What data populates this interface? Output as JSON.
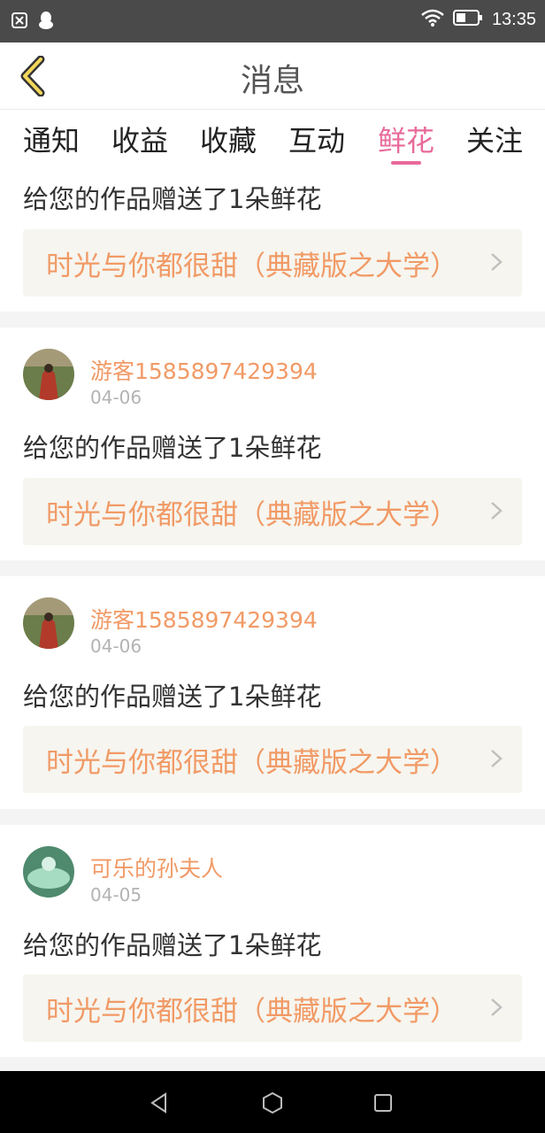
{
  "status_bar": {
    "time": "13:35",
    "icons": [
      "close-box-icon",
      "qq-icon",
      "wifi-icon",
      "battery-icon"
    ]
  },
  "header": {
    "title": "消息",
    "back_icon": "chevron-left-icon"
  },
  "tabs": [
    {
      "label": "通知",
      "active": false
    },
    {
      "label": "收益",
      "active": false
    },
    {
      "label": "收藏",
      "active": false
    },
    {
      "label": "互动",
      "active": false
    },
    {
      "label": "鲜花",
      "active": true
    },
    {
      "label": "关注",
      "active": false
    }
  ],
  "messages": [
    {
      "user": "",
      "date": "",
      "text": "给您的作品赠送了1朵鲜花",
      "work_title": "时光与你都很甜（典藏版之大学）"
    },
    {
      "user": "游客1585897429394",
      "date": "04-06",
      "text": "给您的作品赠送了1朵鲜花",
      "work_title": "时光与你都很甜（典藏版之大学）"
    },
    {
      "user": "游客1585897429394",
      "date": "04-06",
      "text": "给您的作品赠送了1朵鲜花",
      "work_title": "时光与你都很甜（典藏版之大学）"
    },
    {
      "user": "可乐的孙夫人",
      "date": "04-05",
      "text": "给您的作品赠送了1朵鲜花",
      "work_title": "时光与你都很甜（典藏版之大学）"
    }
  ],
  "colors": {
    "accent": "#e86a9a",
    "name": "#f19a66",
    "card_bg": "#f6f5ef",
    "status_bar": "#4a4a4a"
  }
}
